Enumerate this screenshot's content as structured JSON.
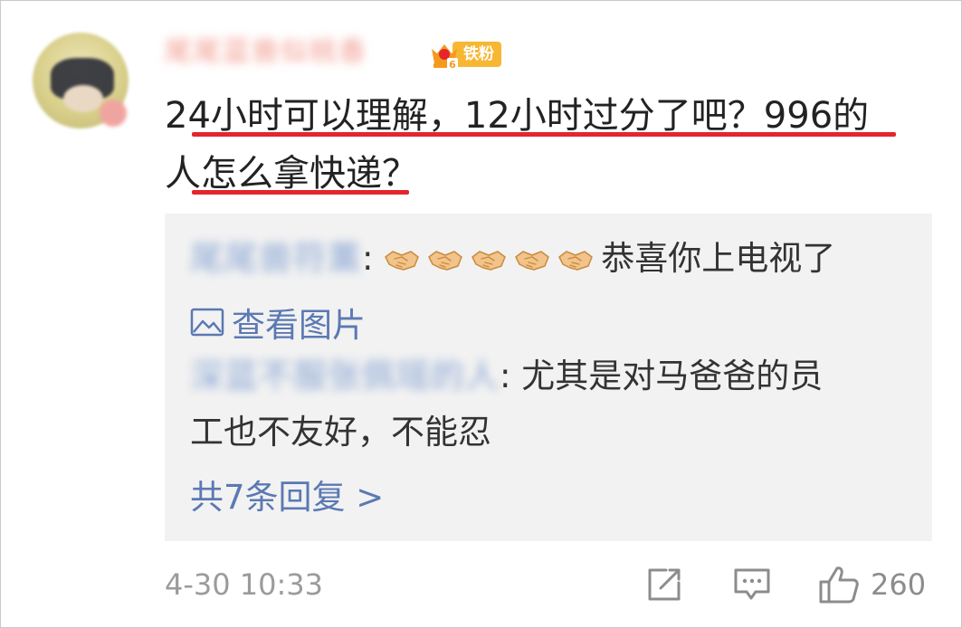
{
  "comment": {
    "username": "尾尾蓝兽似桃香",
    "fan_badge": {
      "level": "6",
      "label": "铁粉"
    },
    "line1": "24小时可以理解，12小时过分了吧？996的",
    "line2": "人怎么拿快递？",
    "timestamp": "4-30 10:33",
    "like_count": "260"
  },
  "replies": [
    {
      "name": "尾尾兽符薰",
      "separator": ":",
      "emoji_count": 5,
      "text": "恭喜你上电视了"
    },
    {
      "view_picture": "查看图片"
    },
    {
      "name": "深蓝不服张佩瑶的人",
      "separator": ":",
      "text_line1": "尤其是对马爸爸的员",
      "text_line2": "工也不友好，不能忍"
    }
  ],
  "more_replies": "共7条回复 >",
  "colors": {
    "link": "#5b79b3",
    "underline": "#e4252e",
    "badge": "#f7b733",
    "reply_bg": "#f2f2f2"
  },
  "icons": [
    "crown-icon",
    "handshake-icon",
    "image-icon",
    "share-icon",
    "comment-icon",
    "like-icon"
  ]
}
